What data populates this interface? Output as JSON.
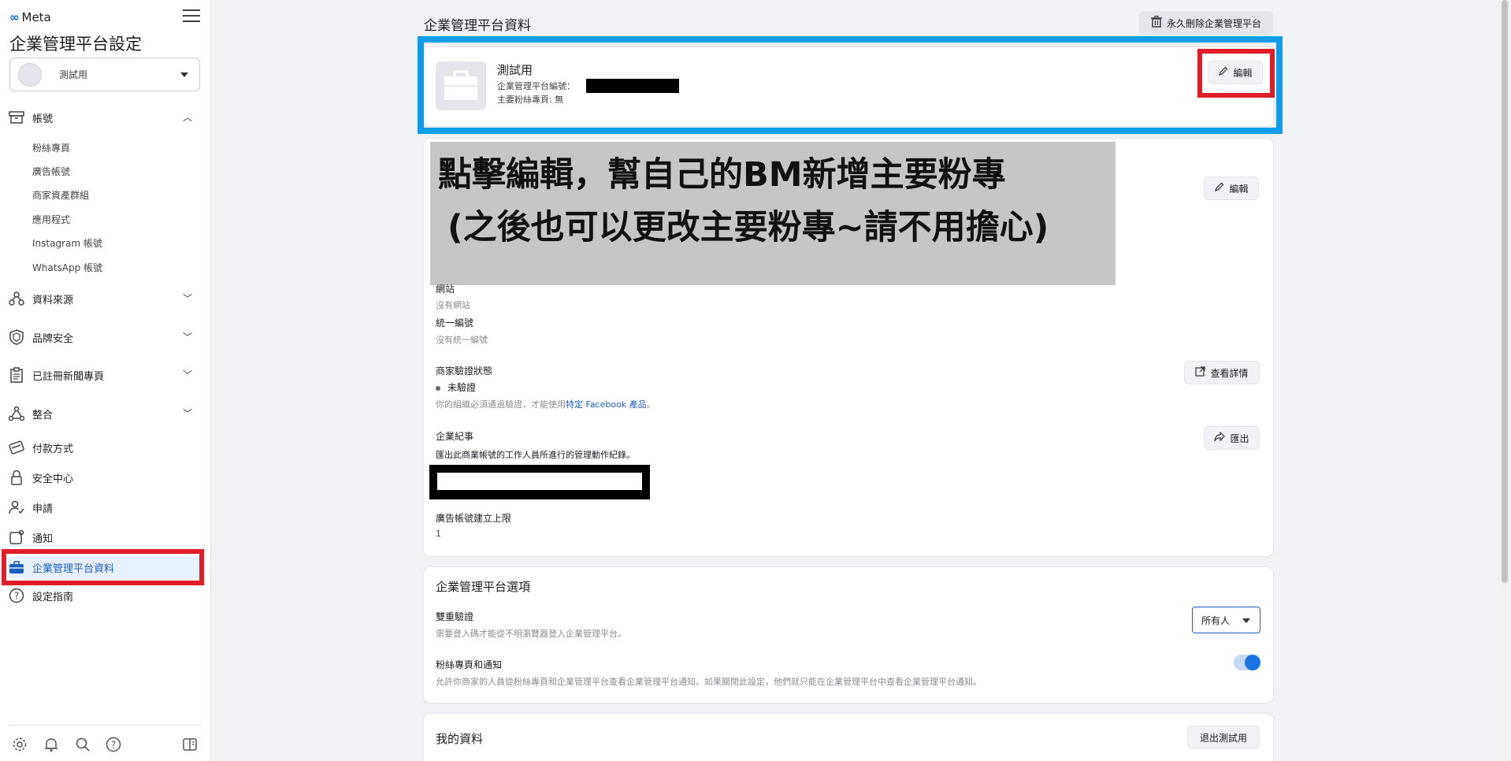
{
  "sidebar": {
    "brand": "Meta",
    "title": "企業管理平台設定",
    "business_name": "測試用",
    "accounts_label": "帳號",
    "accounts_sub": [
      "粉絲專頁",
      "廣告帳號",
      "商家資產群組",
      "應用程式",
      "Instagram 帳號",
      "WhatsApp 帳號"
    ],
    "data_sources": "資料來源",
    "brand_safety": "品牌安全",
    "news_pages": "已註冊新聞專頁",
    "integrations": "整合",
    "payments": "付款方式",
    "security_center": "安全中心",
    "requests": "申請",
    "notifications": "通知",
    "business_info": "企業管理平台資料",
    "setup_guide": "設定指南"
  },
  "header": {
    "title": "企業管理平台資料",
    "delete_button": "永久刪除企業管理平台"
  },
  "business_card": {
    "name": "測試用",
    "id_label": "企業管理平台編號：",
    "primary_page_label": "主要粉絲專頁: 無",
    "edit_label": "編輯"
  },
  "overlay": {
    "line1": "點擊編輯，幫自己的BM新增主要粉專",
    "line2": "(之後也可以更改主要粉專~請不用擔心)"
  },
  "details": {
    "edit_label": "編輯",
    "website_label": "網站",
    "website_value": "沒有網站",
    "tax_label": "統一編號",
    "tax_value": "沒有統一編號",
    "verify_label": "商家驗證狀態",
    "verify_status": "未驗證",
    "verify_note_prefix": "你的組織必須通過驗證，才能使用",
    "verify_note_link": "特定 Facebook 產品",
    "verify_note_suffix": "。",
    "view_details": "查看詳情",
    "log_label": "企業紀事",
    "log_desc": "匯出此商業帳號的工作人員所進行的管理動作紀錄。",
    "export": "匯出",
    "ad_limit_label": "廣告帳號建立上限",
    "ad_limit_value": "1"
  },
  "options": {
    "title": "企業管理平台選項",
    "two_factor_label": "雙重驗證",
    "two_factor_desc": "需要登入碼才能從不明瀏覽器登入企業管理平台。",
    "two_factor_value": "所有人",
    "page_notif_label": "粉絲專頁和通知",
    "page_notif_desc": "允許你商家的人員從粉絲專頁和企業管理平台查看企業管理平台通知。如果關閉此設定，他們就只能在企業管理平台中查看企業管理平台通知。",
    "page_notif_enabled": true
  },
  "my_info": {
    "title": "我的資料",
    "leave_button": "退出測試用"
  },
  "colors": {
    "accent": "#1b74e4",
    "highlight_red": "#e11d2a",
    "highlight_blue": "#0f9ce8"
  }
}
